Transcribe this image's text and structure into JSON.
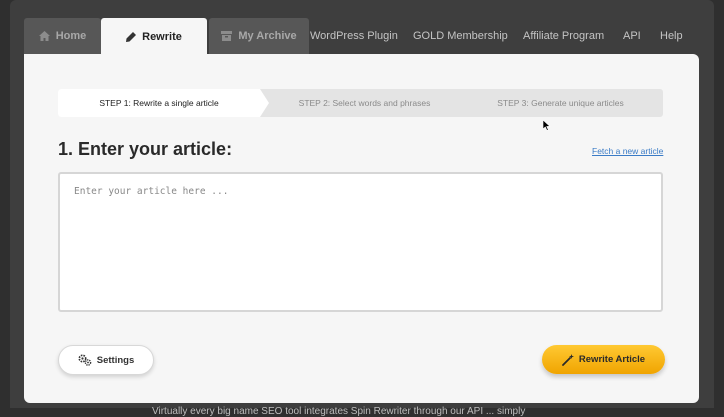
{
  "nav": {
    "tabs": [
      {
        "label": "Home",
        "icon": "home-icon"
      },
      {
        "label": "Rewrite",
        "icon": "pencil-icon",
        "active": true
      },
      {
        "label": "My Archive",
        "icon": "archive-icon"
      }
    ],
    "links": [
      "WordPress Plugin",
      "GOLD Membership",
      "Affiliate Program",
      "API",
      "Help"
    ]
  },
  "steps": [
    {
      "label": "STEP 1: Rewrite a single article",
      "active": true
    },
    {
      "label": "STEP 2: Select words and phrases",
      "active": false
    },
    {
      "label": "STEP 3: Generate unique articles",
      "active": false
    }
  ],
  "main": {
    "heading": "1. Enter your article:",
    "fetch_link": "Fetch a new article",
    "article_placeholder": "Enter your article here ...",
    "article_value": ""
  },
  "buttons": {
    "settings_label": "Settings",
    "rewrite_label": "Rewrite Article"
  },
  "footer_text": "Virtually every big name SEO tool integrates Spin Rewriter through our API ... simply",
  "colors": {
    "accent_button": "#f7b500",
    "link": "#3a7bc6",
    "nav_background": "#3e3e3e"
  }
}
